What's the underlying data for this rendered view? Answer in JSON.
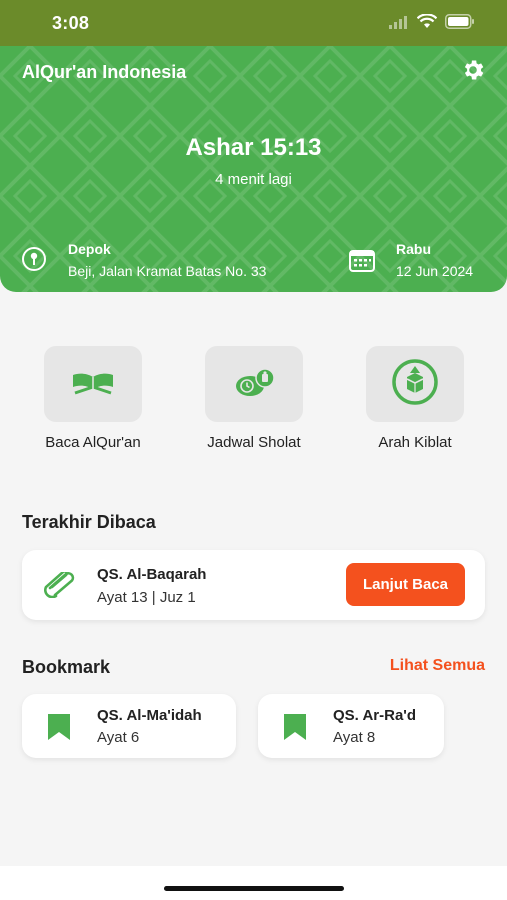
{
  "status_bar": {
    "time": "3:08"
  },
  "header": {
    "app_title": "AlQur'an Indonesia",
    "prayer": "Ashar 15:13",
    "countdown": "4 menit lagi",
    "location_city": "Depok",
    "location_address": "Beji, Jalan Kramat Batas No. 33",
    "day": "Rabu",
    "date": "12 Jun 2024"
  },
  "menu": [
    {
      "label": "Baca AlQur'an",
      "icon": "quran-book-icon"
    },
    {
      "label": "Jadwal Sholat",
      "icon": "prayer-schedule-icon"
    },
    {
      "label": "Arah Kiblat",
      "icon": "compass-kaaba-icon"
    }
  ],
  "last_read": {
    "section_title": "Terakhir Dibaca",
    "surah": "QS. Al-Baqarah",
    "detail": "Ayat 13 | Juz 1",
    "button_label": "Lanjut Baca"
  },
  "bookmark": {
    "section_title": "Bookmark",
    "see_all_label": "Lihat Semua",
    "items": [
      {
        "surah": "QS. Al-Ma'idah",
        "ayat": "Ayat 6"
      },
      {
        "surah": "QS. Ar-Ra'd",
        "ayat": "Ayat 8"
      }
    ]
  },
  "colors": {
    "primary": "#4caf50",
    "accent": "#f4511e",
    "status_bar": "#6b8b2a"
  }
}
